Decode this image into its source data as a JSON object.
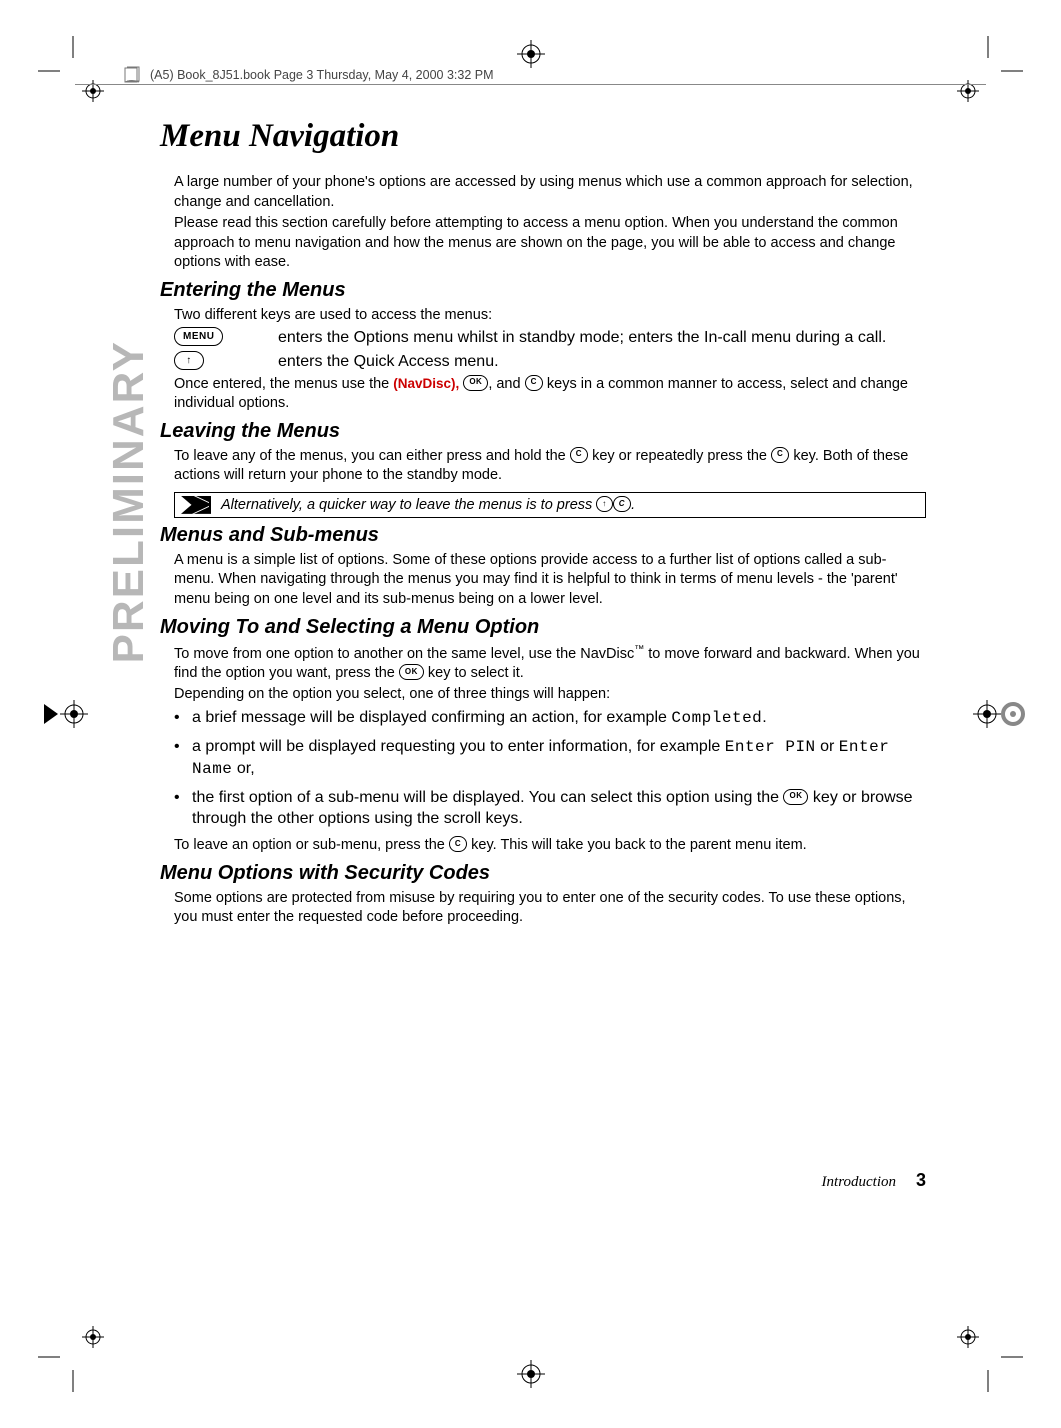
{
  "crop_marks": {
    "present": true
  },
  "book_header": "(A5) Book_8J51.book  Page 3  Thursday, May 4, 2000  3:32 PM",
  "sidebar_word": "PRELIMINARY",
  "chapter_title": "Menu Navigation",
  "intro_p1": "A large number of your phone's options are accessed by using menus which use a common approach for selection, change and cancellation.",
  "intro_p2": "Please read this section carefully before attempting to access a menu option. When you understand the common approach to menu navigation and how the menus are shown on the page, you will be able to access and change options with ease.",
  "entering": {
    "title": "Entering the Menus",
    "lead": "Two different keys are used to access the menus:",
    "menu_key_label": "MENU",
    "menu_key_text": "enters the Options menu whilst in standby mode; enters the In-call menu during a call.",
    "up_key_glyph": "↑",
    "up_key_text": "enters the Quick Access menu.",
    "post_prefix": "Once entered, the menus use the ",
    "navdisc_text": "(NavDisc),",
    "ok_label": "OK",
    "c_label": "C",
    "post_mid": ", and ",
    "post_suffix": " keys in a common manner to access, select and change individual options."
  },
  "leaving": {
    "title": "Leaving the Menus",
    "p_prefix": "To leave any of the menus, you can either press and hold the ",
    "p_mid": " key or repeatedly press the ",
    "p_suffix": " key. Both of these actions will return your phone to the standby mode.",
    "note_prefix": "Alternatively, a quicker way to leave the menus is to press ",
    "note_suffix": "."
  },
  "submenus": {
    "title": "Menus and Sub-menus",
    "p": "A menu is a simple list of options. Some of these options provide access to a further list of options called a sub-menu. When navigating through the menus you may find it is helpful to think in terms of menu levels - the 'parent' menu being on one level and its sub-menus being on a lower level."
  },
  "moving": {
    "title": "Moving To and Selecting a Menu Option",
    "p1_prefix": "To move from one option to another on the same level, use the NavDisc",
    "tm": "™",
    "p1_mid": " to move forward and backward. When you find the option you want, press the ",
    "p1_suffix": " key to select it.",
    "p2": "Depending on the option you select, one of three things will happen:",
    "bullets": {
      "b1_prefix": "a brief message will be displayed confirming an action, for example ",
      "b1_code": "Completed",
      "b1_suffix": ".",
      "b2_prefix": "a prompt will be displayed requesting you to enter information, for example ",
      "b2_code_a": "Enter PIN",
      "b2_mid": " or ",
      "b2_code_b": "Enter Name",
      "b2_suffix": " or,",
      "b3_prefix": "the first option of a sub-menu will be displayed. You can select this option using the ",
      "b3_suffix": " key or browse through the other options using the scroll keys."
    },
    "p3_prefix": "To leave an option or sub-menu, press the ",
    "p3_suffix": " key. This will take you back to the parent menu item."
  },
  "security": {
    "title": "Menu Options with Security Codes",
    "p": "Some options are protected from misuse by requiring you to enter one of the security codes. To use these options, you must enter the requested code before proceeding."
  },
  "footer": {
    "section": "Introduction",
    "page": "3"
  }
}
